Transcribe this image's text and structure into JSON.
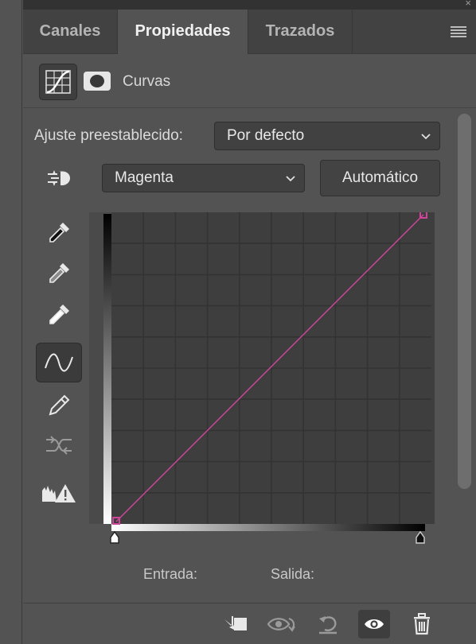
{
  "tabs": [
    {
      "label": "Canales",
      "active": false
    },
    {
      "label": "Propiedades",
      "active": true
    },
    {
      "label": "Trazados",
      "active": false
    }
  ],
  "header": {
    "title": "Curvas"
  },
  "preset": {
    "label": "Ajuste preestablecido:",
    "value": "Por defecto"
  },
  "channel": {
    "value": "Magenta"
  },
  "auto_button": {
    "label": "Automático"
  },
  "io": {
    "input_label": "Entrada:",
    "output_label": "Salida:"
  },
  "curve": {
    "color": "#d0449b",
    "points": [
      [
        0,
        0
      ],
      [
        255,
        255
      ]
    ]
  },
  "colors": {
    "panel": "#535353",
    "tabbar": "#424242",
    "graph_bg": "#3e3e3e",
    "grid": "#333333",
    "curve": "#d0449b"
  },
  "tools": [
    "sample-in-image-icon",
    "black-point-eyedropper-icon",
    "gray-point-eyedropper-icon",
    "white-point-eyedropper-icon",
    "edit-curve-points-icon",
    "draw-curve-pencil-icon",
    "smooth-curve-icon",
    "clipping-warning-icon"
  ],
  "bottom_icons": [
    "clip-to-layer-icon",
    "view-previous-state-icon",
    "reset-icon",
    "visibility-eye-icon",
    "trash-icon"
  ]
}
